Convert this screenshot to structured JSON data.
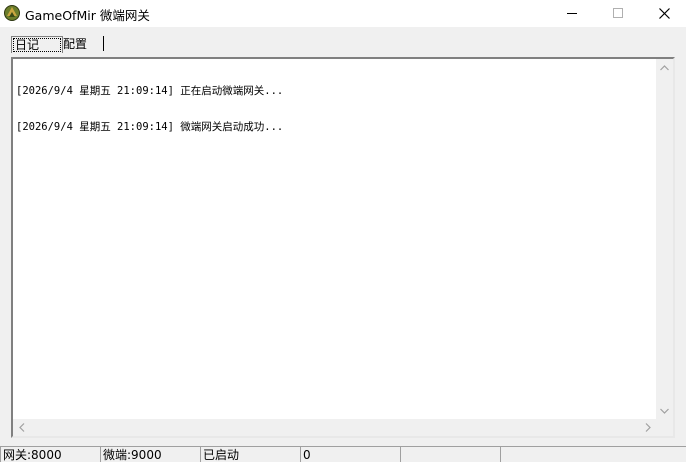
{
  "window": {
    "title": "GameOfMir 微端网关",
    "icon": "app-logo-icon"
  },
  "tabs": [
    {
      "label": "日记",
      "selected": true
    },
    {
      "label": "配置",
      "selected": false
    }
  ],
  "log": {
    "lines": [
      "[2026/9/4 星期五 21:09:14] 正在启动微端网关...",
      "[2026/9/4 星期五 21:09:14] 微端网关启动成功..."
    ]
  },
  "statusbar": {
    "gateway_port": "网关:8000",
    "microclient_port": "微端:9000",
    "state": "已启动",
    "connections": "0",
    "extra1": "",
    "extra2": ""
  }
}
